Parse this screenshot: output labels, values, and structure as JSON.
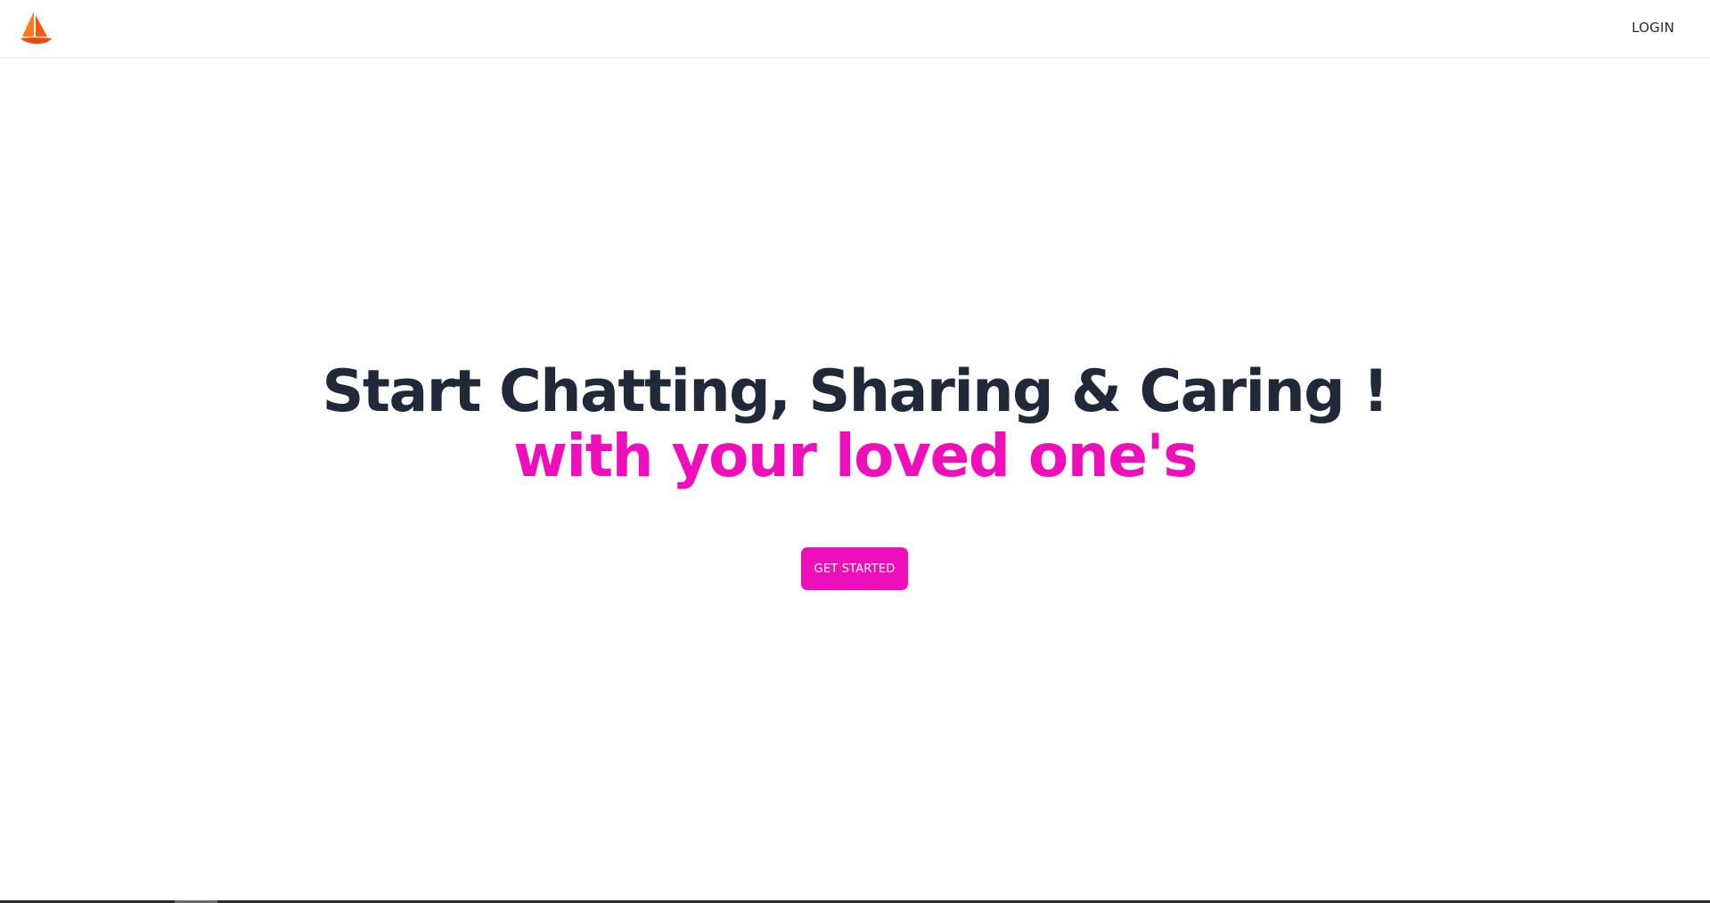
{
  "header": {
    "logo_icon": "sailboat-icon",
    "logo_colors": [
      "#ff6a00",
      "#e84d0e"
    ],
    "login_label": "LOGIN"
  },
  "hero": {
    "headline": "Start Chatting, Sharing & Caring !",
    "subline": "with your loved one's",
    "cta_label": "GET STARTED"
  },
  "colors": {
    "headline": "#1f2937",
    "accent": "#ee0fbb",
    "background": "#ffffff"
  }
}
